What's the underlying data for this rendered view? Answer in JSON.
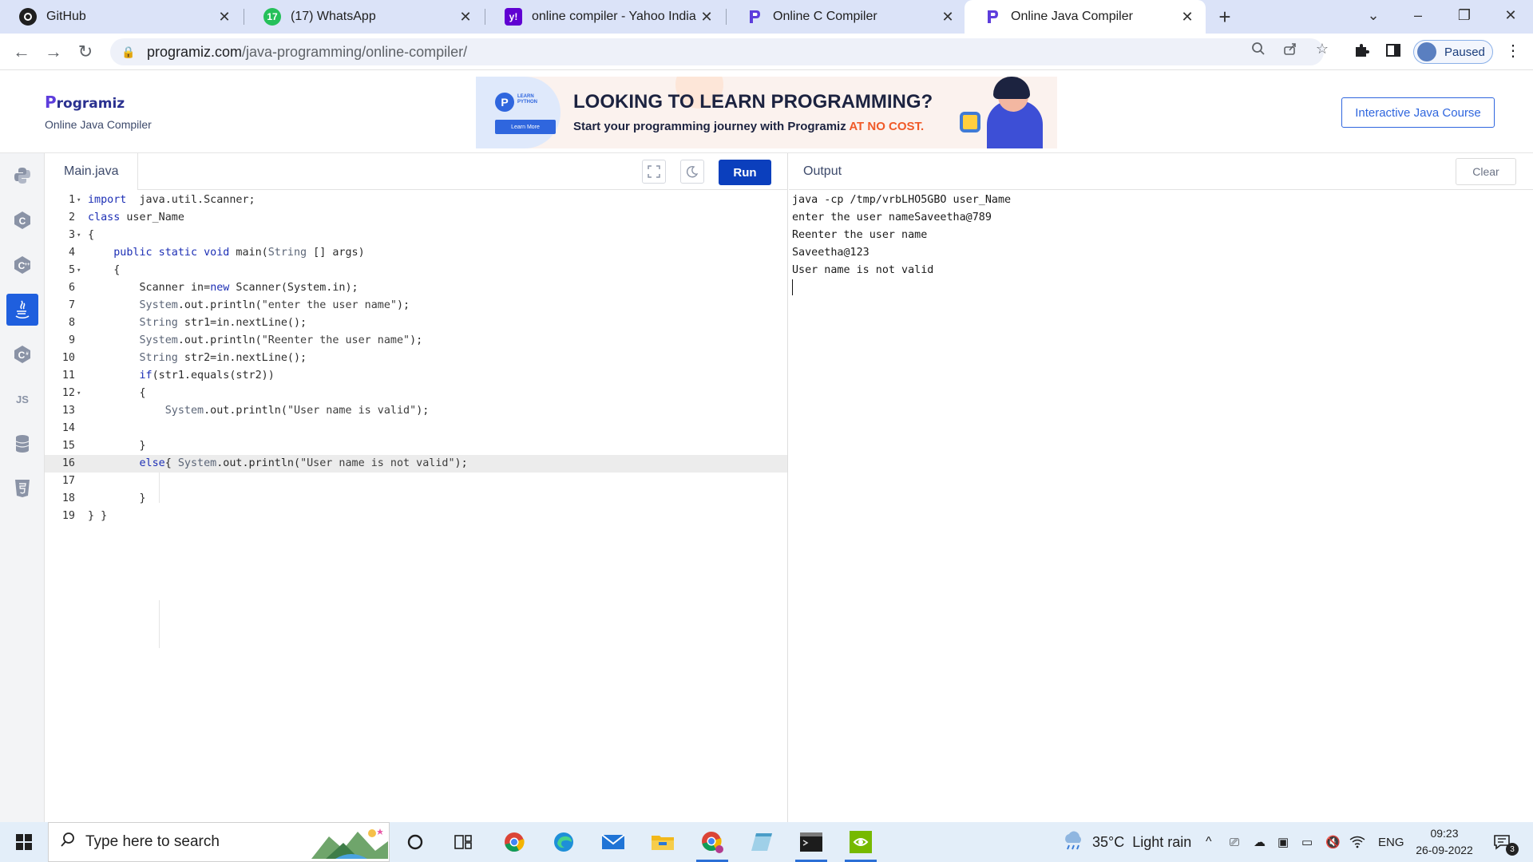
{
  "browser": {
    "tabs": [
      {
        "title": "GitHub",
        "icon": "github-icon"
      },
      {
        "title": "(17) WhatsApp",
        "icon": "whatsapp-icon",
        "badge": "17"
      },
      {
        "title": "online compiler - Yahoo India Se",
        "icon": "yahoo-icon",
        "fav_text": "y!"
      },
      {
        "title": "Online C Compiler",
        "icon": "programiz-icon"
      },
      {
        "title": "Online Java Compiler",
        "icon": "programiz-icon",
        "active": true
      }
    ],
    "url_host": "programiz.com",
    "url_path": "/java-programming/online-compiler/",
    "profile_status": "Paused"
  },
  "site": {
    "logo_text": "rogramiz",
    "logo_initial": "P",
    "subtitle": "Online Java Compiler",
    "banner": {
      "logo_caption_1": "LEARN",
      "logo_caption_2": "PYTHON",
      "learn_more": "Learn More",
      "headline": "LOOKING TO LEARN PROGRAMMING?",
      "tagline": "Start your programming journey with Programiz ",
      "tagline_accent": "AT NO COST."
    },
    "course_button": "Interactive Java Course"
  },
  "rail": {
    "items": [
      "python-icon",
      "c-icon",
      "cpp-icon",
      "java-icon",
      "csharp-icon",
      "javascript-icon",
      "sql-icon",
      "html-icon"
    ],
    "active": "java-icon",
    "js_label": "JS"
  },
  "editor": {
    "filename": "Main.java",
    "run_label": "Run",
    "highlighted_line": 16,
    "lines": [
      {
        "n": "1",
        "fold": true,
        "segs": [
          [
            "kw",
            "import"
          ],
          [
            "",
            "  java.util.Scanner;"
          ]
        ]
      },
      {
        "n": "2",
        "segs": [
          [
            "kw",
            "class"
          ],
          [
            "",
            " user_Name"
          ]
        ]
      },
      {
        "n": "3",
        "fold": true,
        "segs": [
          [
            "",
            "{"
          ]
        ]
      },
      {
        "n": "4",
        "segs": [
          [
            "",
            "    "
          ],
          [
            "kw",
            "public static void"
          ],
          [
            "",
            " main("
          ],
          [
            "tp",
            "String"
          ],
          [
            "",
            " [] args)"
          ]
        ]
      },
      {
        "n": "5",
        "fold": true,
        "segs": [
          [
            "",
            "    {"
          ]
        ]
      },
      {
        "n": "6",
        "segs": [
          [
            "",
            "        Scanner in="
          ],
          [
            "kw",
            "new"
          ],
          [
            "",
            " Scanner(System.in);"
          ]
        ]
      },
      {
        "n": "7",
        "segs": [
          [
            "",
            "        "
          ],
          [
            "tp",
            "System"
          ],
          [
            "",
            ".out.println("
          ],
          [
            "str",
            "\"enter the user name\""
          ],
          [
            "",
            ");"
          ]
        ]
      },
      {
        "n": "8",
        "segs": [
          [
            "",
            "        "
          ],
          [
            "tp",
            "String"
          ],
          [
            "",
            " str1=in.nextLine();"
          ]
        ]
      },
      {
        "n": "9",
        "segs": [
          [
            "",
            "        "
          ],
          [
            "tp",
            "System"
          ],
          [
            "",
            ".out.println("
          ],
          [
            "str",
            "\"Reenter the user name\""
          ],
          [
            "",
            ");"
          ]
        ]
      },
      {
        "n": "10",
        "segs": [
          [
            "",
            "        "
          ],
          [
            "tp",
            "String"
          ],
          [
            "",
            " str2=in.nextLine();"
          ]
        ]
      },
      {
        "n": "11",
        "segs": [
          [
            "",
            "        "
          ],
          [
            "kw",
            "if"
          ],
          [
            "",
            "(str1.equals(str2))"
          ]
        ]
      },
      {
        "n": "12",
        "fold": true,
        "segs": [
          [
            "",
            "        {"
          ]
        ]
      },
      {
        "n": "13",
        "segs": [
          [
            "",
            "            "
          ],
          [
            "tp",
            "System"
          ],
          [
            "",
            ".out.println("
          ],
          [
            "str",
            "\"User name is valid\""
          ],
          [
            "",
            ");"
          ]
        ]
      },
      {
        "n": "14",
        "segs": [
          [
            "",
            ""
          ]
        ]
      },
      {
        "n": "15",
        "segs": [
          [
            "",
            "        }"
          ]
        ]
      },
      {
        "n": "16",
        "segs": [
          [
            "",
            "        "
          ],
          [
            "kw",
            "else"
          ],
          [
            "",
            "{ "
          ],
          [
            "tp",
            "System"
          ],
          [
            "",
            ".out.println("
          ],
          [
            "str",
            "\"User name is not valid\""
          ],
          [
            "",
            ");"
          ]
        ]
      },
      {
        "n": "17",
        "segs": [
          [
            "",
            ""
          ]
        ]
      },
      {
        "n": "18",
        "segs": [
          [
            "",
            "        }"
          ]
        ]
      },
      {
        "n": "19",
        "segs": [
          [
            "",
            "} }"
          ]
        ]
      }
    ]
  },
  "output": {
    "title": "Output",
    "clear_label": "Clear",
    "lines": [
      "java -cp /tmp/vrbLHO5GBO user_Name",
      "enter the user nameSaveetha@789",
      "Reenter the user name",
      "Saveetha@123",
      "User name is not valid"
    ]
  },
  "taskbar": {
    "search_placeholder": "Type here to search",
    "weather_temp": "35°C",
    "weather_desc": "Light rain",
    "language": "ENG",
    "time": "09:23",
    "date": "26-09-2022",
    "notification_count": "3"
  },
  "colors": {
    "accent": "#1f5fde",
    "run_button": "#0b3fbd",
    "tab_strip": "#dbe3f8",
    "banner_accent": "#f05a28"
  }
}
